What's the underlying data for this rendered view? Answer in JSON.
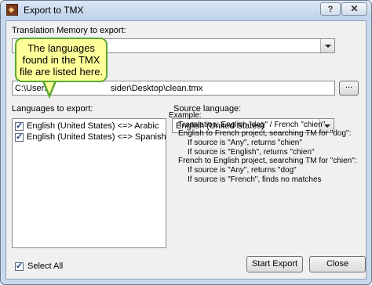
{
  "window": {
    "title": "Export to TMX",
    "help_label": "?",
    "close_label": "✕"
  },
  "tm_section": {
    "label": "Translation Memory to export:",
    "selected": ""
  },
  "file_section": {
    "path_prefix": "C:\\Users\\",
    "path_suffix": "sider\\Desktop\\clean.tmx",
    "browse_label": "..."
  },
  "languages": {
    "label": "Languages to export:",
    "items": [
      {
        "label": "English (United States) <=> Arabic",
        "checked": true
      },
      {
        "label": "English (United States) <=> Spanish",
        "checked": true
      }
    ]
  },
  "source_language": {
    "label": "Source language:",
    "selected": "English (United States)"
  },
  "example": {
    "lines": [
      "Example:",
      "Translation: English \"dog\" / French \"chien\"",
      "English to French project, searching TM for \"dog\":",
      "If source is \"Any\", returns \"chien\"",
      "If source is \"English\", returns \"chien\"",
      "French to English project, searching TM for \"chien\":",
      "If source is \"Any\", returns \"dog\"",
      "If source is \"French\", finds no matches"
    ]
  },
  "select_all": {
    "label": "Select All",
    "checked": true
  },
  "buttons": {
    "start_export": "Start Export",
    "close": "Close"
  },
  "callout": {
    "line1": "The languages",
    "line2": "found in the TMX",
    "line3": "file are listed here."
  }
}
